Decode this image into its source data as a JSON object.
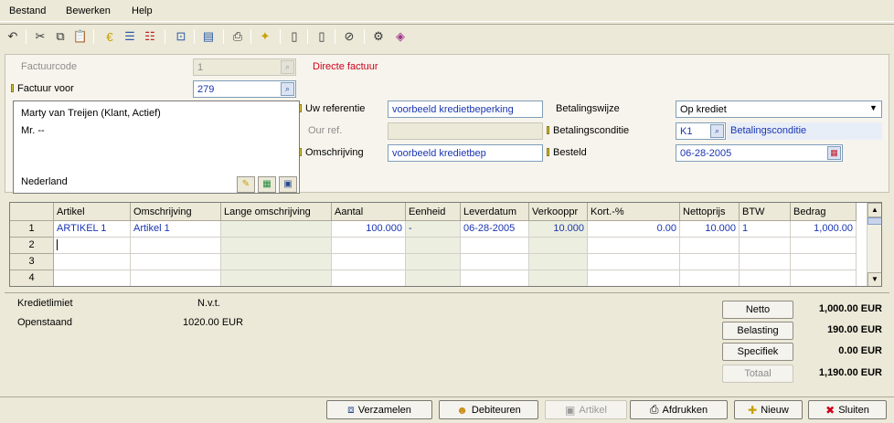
{
  "menu": [
    {
      "label": "Bestand"
    },
    {
      "label": "Bewerken"
    },
    {
      "label": "Help"
    }
  ],
  "header": {
    "factuurcode_label": "Factuurcode",
    "factuurcode_value": "1",
    "direct_label": "Directe factuur",
    "factuur_voor_label": "Factuur voor",
    "factuur_voor_value": "279"
  },
  "address": {
    "name": "Marty van Treijen (Klant, Actief)",
    "salutation": "Mr. --",
    "country": "Nederland"
  },
  "mid": {
    "uw_ref_label": "Uw referentie",
    "uw_ref_value": "voorbeeld kredietbeperking",
    "our_ref_label": "Our ref.",
    "our_ref_value": "",
    "omschrijving_label": "Omschrijving",
    "omschrijving_value": "voorbeeld kredietbep"
  },
  "right": {
    "betalingswijze_label": "Betalingswijze",
    "betalingswijze_value": "Op krediet",
    "betalingsconditie_label": "Betalingsconditie",
    "betalingsconditie_code": "K1",
    "betalingsconditie_desc": "Betalingsconditie",
    "besteld_label": "Besteld",
    "besteld_value": "06-28-2005"
  },
  "grid": {
    "columns": [
      "Artikel",
      "Omschrijving",
      "Lange omschrijving",
      "Aantal",
      "Eenheid",
      "Leverdatum",
      "Verkooppr",
      "Kort.-%",
      "Nettoprijs",
      "BTW",
      "Bedrag"
    ],
    "row_numbers": [
      "1",
      "2",
      "3",
      "4"
    ],
    "rows": [
      {
        "artikel": "ARTIKEL 1",
        "omschrijving": "Artikel 1",
        "lange": "",
        "aantal": "100.000",
        "eenheid": "-",
        "leverdatum": "06-28-2005",
        "verkooppr": "10.000",
        "korting": "0.00",
        "nettoprijs": "10.000",
        "btw": "1",
        "bedrag": "1,000.00"
      }
    ]
  },
  "summary": {
    "kredietlimiet_label": "Kredietlimiet",
    "kredietlimiet_value": "N.v.t.",
    "openstaand_label": "Openstaand",
    "openstaand_value": "1020.00 EUR",
    "netto_label": "Netto",
    "netto_value": "1,000.00 EUR",
    "belasting_label": "Belasting",
    "belasting_value": "190.00 EUR",
    "specifiek_label": "Specifiek",
    "specifiek_value": "0.00 EUR",
    "totaal_label": "Totaal",
    "totaal_value": "1,190.00 EUR"
  },
  "footer": {
    "verzamelen": "Verzamelen",
    "debiteuren": "Debiteuren",
    "artikel": "Artikel",
    "afdrukken": "Afdrukken",
    "nieuw": "Nieuw",
    "sluiten": "Sluiten"
  },
  "colors": {
    "accent_red": "#d0001c",
    "value_blue": "#1a35b0",
    "window_bg": "#ece9d8"
  }
}
